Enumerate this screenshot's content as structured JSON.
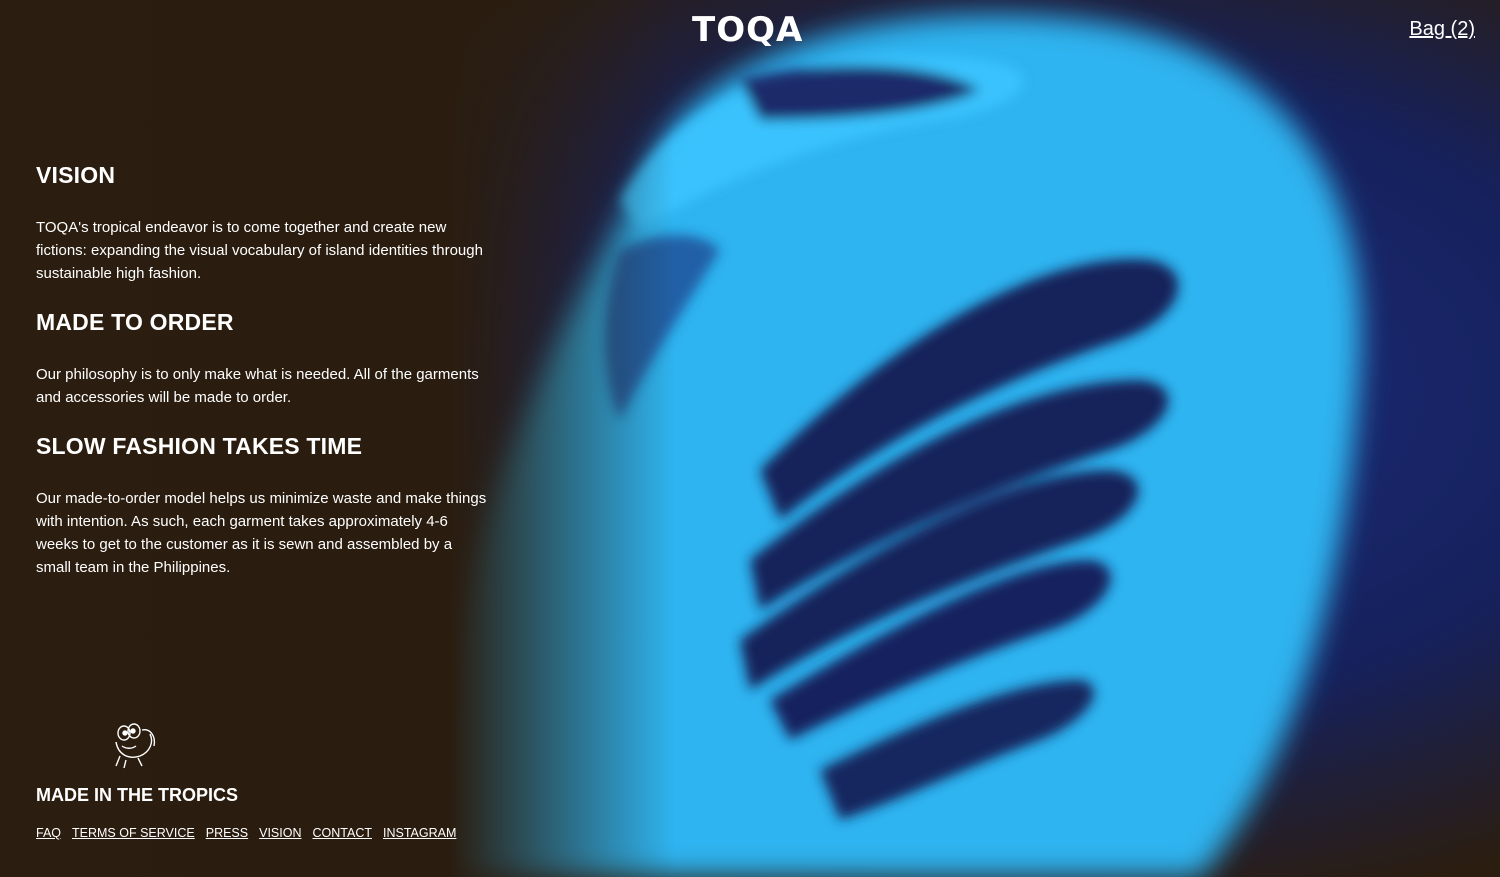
{
  "header": {
    "logo": "TOQA",
    "bag_label": "Bag (2)"
  },
  "sections": [
    {
      "title": "VISION",
      "body": "TOQA's tropical endeavor is to come together and create new fictions: expanding the visual vocabulary of island identities through sustainable high fashion."
    },
    {
      "title": "MADE TO ORDER",
      "body": "Our philosophy is to only make what is needed. All of the garments and accessories will be made to order."
    },
    {
      "title": "SLOW FASHION TAKES TIME",
      "body": "Our made-to-order model helps us minimize waste and make things with intention. As such, each garment takes approximately 4-6 weeks to get to the customer as it is sewn and assembled by a small team in the Philippines."
    }
  ],
  "footer": {
    "mascot_icon": "frog-mascot-icon",
    "title": "MADE IN THE TROPICS",
    "links": [
      "FAQ",
      "TERMS OF SERVICE",
      "PRESS",
      "VISION",
      "CONTACT",
      "INSTAGRAM"
    ]
  },
  "colors": {
    "background_brown": "#2b1d0f",
    "photo_blue": "#2fb4f0",
    "photo_navy": "#13205a",
    "text": "#ffffff"
  }
}
